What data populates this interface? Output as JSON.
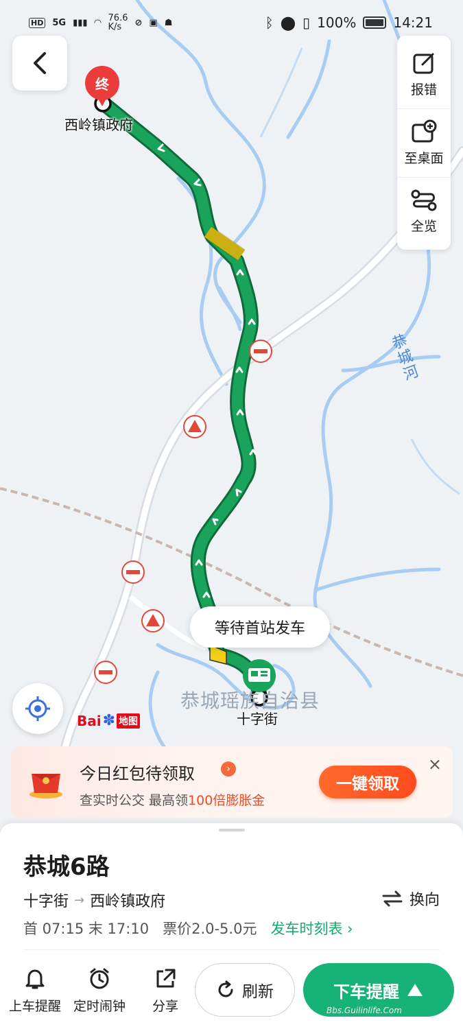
{
  "status_bar": {
    "network": "HD",
    "signal": "5G",
    "speed_value": "76.6",
    "speed_unit": "K/s",
    "battery": "100%",
    "time": "14:21"
  },
  "toolbar": {
    "report_label": "报错",
    "desktop_label": "至桌面",
    "overview_label": "全览"
  },
  "map": {
    "end_marker_label": "终",
    "end_stop_label": "西岭镇政府",
    "start_stop_label": "十字街",
    "county_label": "恭城瑶族自治县",
    "river_label": "恭城河",
    "bubble_text": "等待首站发车",
    "logo_text": "Bai",
    "logo_map": "地图"
  },
  "promo": {
    "title": "今日红包待领取",
    "sub_prefix": "查实时公交 最高领",
    "sub_highlight": "100倍膨胀金",
    "button": "一键领取",
    "close": "×"
  },
  "route": {
    "name": "恭城6路",
    "from": "十字街",
    "to": "西岭镇政府",
    "reverse_label": "换向",
    "first_label": "首 07:15 末 17:10",
    "fare": "票价2.0-5.0元",
    "schedule_label": "发车时刻表"
  },
  "actions": {
    "board_remind": "上车提醒",
    "alarm": "定时闹钟",
    "share": "分享",
    "refresh": "刷新",
    "alight_remind": "下车提醒"
  },
  "watermark": "Bbs.Guilinlife.Com",
  "colors": {
    "route_green": "#1aa35a",
    "accent_green": "#17b277",
    "end_red": "#ec3b3b",
    "river_blue": "#a9cdf2"
  }
}
